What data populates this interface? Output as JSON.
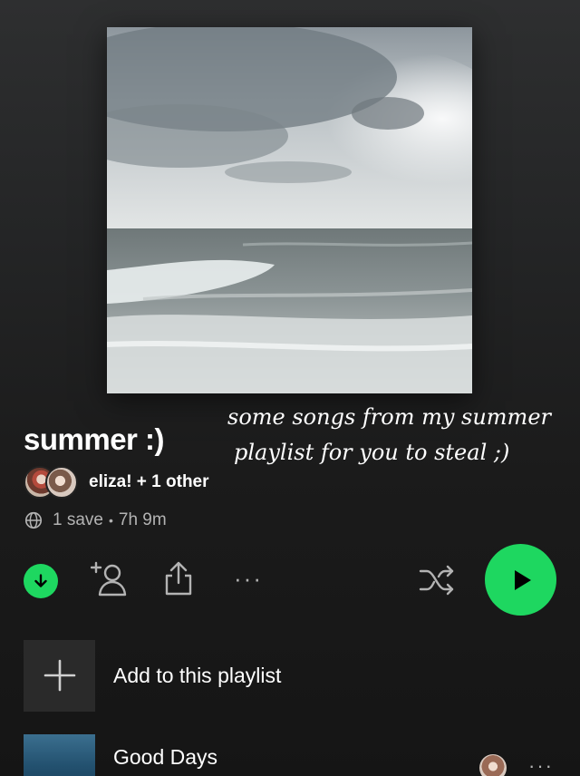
{
  "playlist": {
    "title": "summer :)",
    "caption_line1": "some songs from my summer",
    "caption_line2": "playlist for you to steal ;)",
    "owners": "eliza! + 1 other",
    "saves": "1 save",
    "separator": "•",
    "duration": "7h 9m"
  },
  "controls": {
    "download_icon": "download-icon",
    "add_user_icon": "add-user-icon",
    "share_icon": "share-icon",
    "more_icon": "more-icon",
    "more_glyph": "···",
    "shuffle_icon": "shuffle-icon",
    "play_icon": "play-icon"
  },
  "add_row": {
    "label": "Add to this playlist",
    "icon": "plus-icon"
  },
  "tracks": [
    {
      "title": "Good Days",
      "more_glyph": "···"
    }
  ],
  "colors": {
    "accent": "#1ed760",
    "background": "#1b1b1b",
    "secondary_text": "#b3b3b3"
  }
}
